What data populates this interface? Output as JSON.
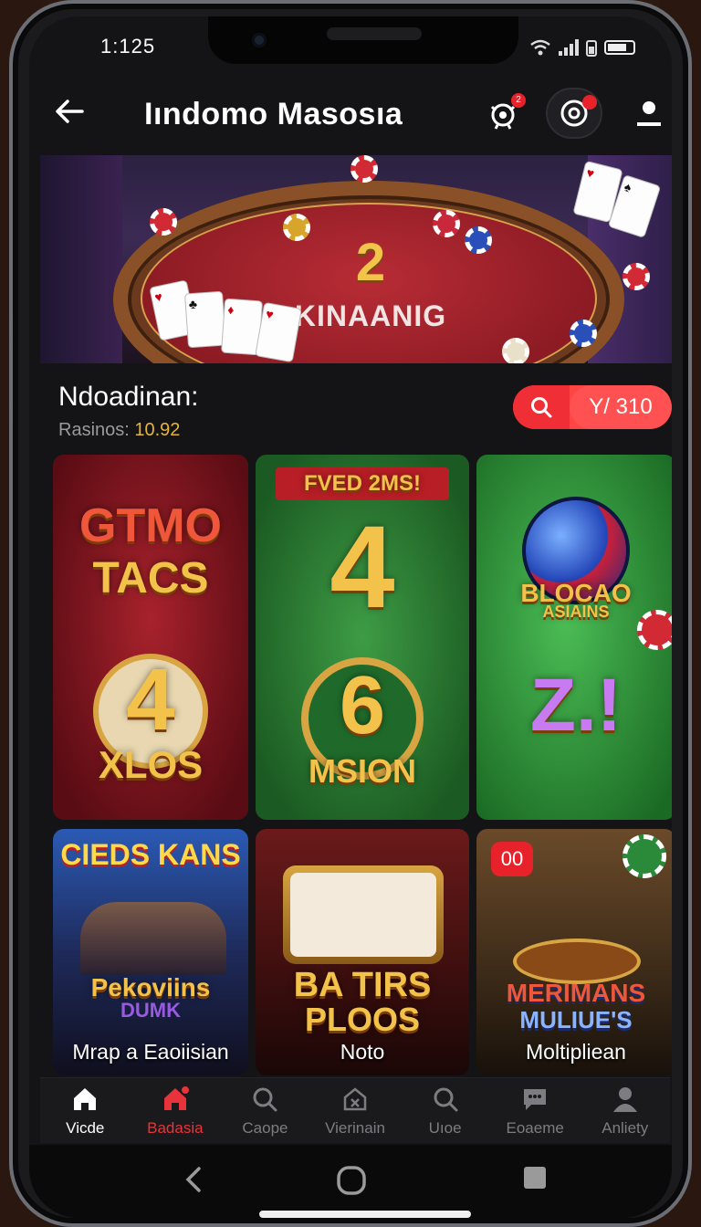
{
  "status": {
    "time": "1:125"
  },
  "header": {
    "title": "Iındomo Masosıa",
    "badge_left": "2"
  },
  "banner": {
    "number": "2",
    "text": "KINAANIG"
  },
  "section": {
    "title": "Ndoadinan:",
    "sub_label": "Rasinos:",
    "sub_value": "10.92",
    "pill_value": "Y/ 310"
  },
  "games": [
    {
      "art_top": "GTMO",
      "art_mid": "TACS",
      "art_num": "4",
      "art_bottom": "XLOS"
    },
    {
      "banner": "FVED 2MS!",
      "art_num": "4",
      "art_num2": "6",
      "art_bottom": "MSION"
    },
    {
      "art_top": "BLOCAO",
      "art_sub": "ASIAINS",
      "art_bottom": "Z.!"
    },
    {
      "art_top": "CIEDS KANS",
      "art_mid": "Pekoviins",
      "art_sub": "DUMK",
      "label": "Mrap a Eaoiisian"
    },
    {
      "art_top": "BA TIRS",
      "art_bottom": "PLOOS",
      "label": "Noto"
    },
    {
      "badge": "00",
      "art_top": "MERIMANS",
      "art_bottom": "MULIUE'S",
      "label": "Moltipliean"
    }
  ],
  "nav": [
    {
      "label": "Vicde",
      "icon": "home-icon"
    },
    {
      "label": "Badasia",
      "icon": "house-hot-icon"
    },
    {
      "label": "Caope",
      "icon": "search-icon"
    },
    {
      "label": "Vierinain",
      "icon": "box-icon"
    },
    {
      "label": "Uıoe",
      "icon": "search-icon"
    },
    {
      "label": "Eoaeme",
      "icon": "chat-icon"
    },
    {
      "label": "Anliety",
      "icon": "user-icon"
    }
  ],
  "colors": {
    "accent": "#e8222a",
    "gold": "#f2c24a",
    "background": "#141416"
  }
}
